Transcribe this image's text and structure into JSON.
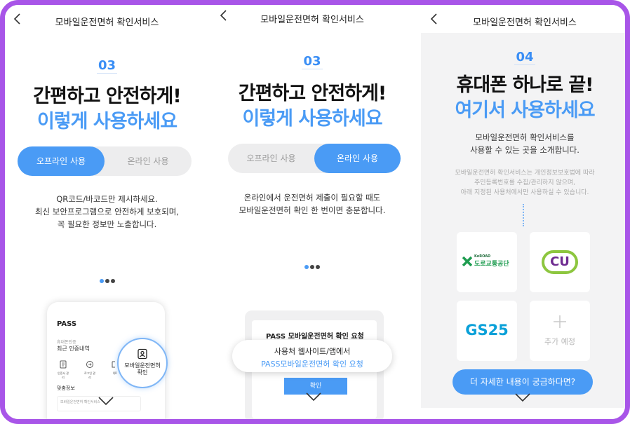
{
  "panels": [
    {
      "title": "모바일운전면허 확인서비스",
      "step": "03",
      "headline": "간편하고 안전하게!",
      "subheadline": "이렇게 사용하세요",
      "toggle": {
        "left": "오프라인 사용",
        "right": "온라인 사용",
        "active": "left"
      },
      "description": [
        "QR코드/바코드만 제시하세요.",
        "최신 보안프로그램으로 안전하게 보호되며,",
        "꼭 필요한 정보만 노출합니다."
      ],
      "pager_active": 0,
      "mockup": {
        "app": "PASS",
        "sub": "휴대폰인증",
        "history": "최근 인증내역",
        "icons": [
          "인증서 관리",
          "로그인 관리",
          "QR"
        ],
        "section": "맞춤정보",
        "row": "모바일운전면허 확인서비스",
        "badge_line1": "모바일운전면허",
        "badge_line2": "확인"
      }
    },
    {
      "title": "모바일운전면허 확인서비스",
      "step": "03",
      "headline": "간편하고 안전하게!",
      "subheadline": "이렇게 사용하세요",
      "toggle": {
        "left": "오프라인 사용",
        "right": "온라인 사용",
        "active": "right"
      },
      "description": [
        "온라인에서 운전면허 제출이 필요할 때도",
        "모바일운전면허 확인 한 번이면 충분합니다."
      ],
      "pager_active": 0,
      "mockup": {
        "header": "PASS 모바일운전면허 확인 요청",
        "bubble_line1": "사용처 웹사이트/앱에서",
        "bubble_line2": "PASS모바일운전면허 확인 요청",
        "confirm": "확인"
      }
    },
    {
      "title": "모바일운전면허 확인서비스",
      "step": "04",
      "headline": "휴대폰 하나로 끝!",
      "subheadline": "여기서 사용하세요",
      "description": [
        "모바일운전면허 확인서비스를",
        "사용할 수 있는 곳을 소개합니다."
      ],
      "note": [
        "모바일운전면허 확인서비스는 개인정보보호법에 따라",
        "주민등록번호를 수집/관리하지 않으며,",
        "아래 지정된 사용처에서만 사용하실 수 있습니다."
      ],
      "partners": [
        {
          "name": "도로교통공단",
          "sub": "KoROAD"
        },
        {
          "name": "CU"
        },
        {
          "name": "GS25"
        },
        {
          "name": "추가 예정"
        }
      ],
      "cta": "더 자세한 내용이 궁금하다면?"
    }
  ],
  "colors": {
    "accent": "#4a9bf5",
    "frame": "#a855e8",
    "headline": "#111111"
  }
}
